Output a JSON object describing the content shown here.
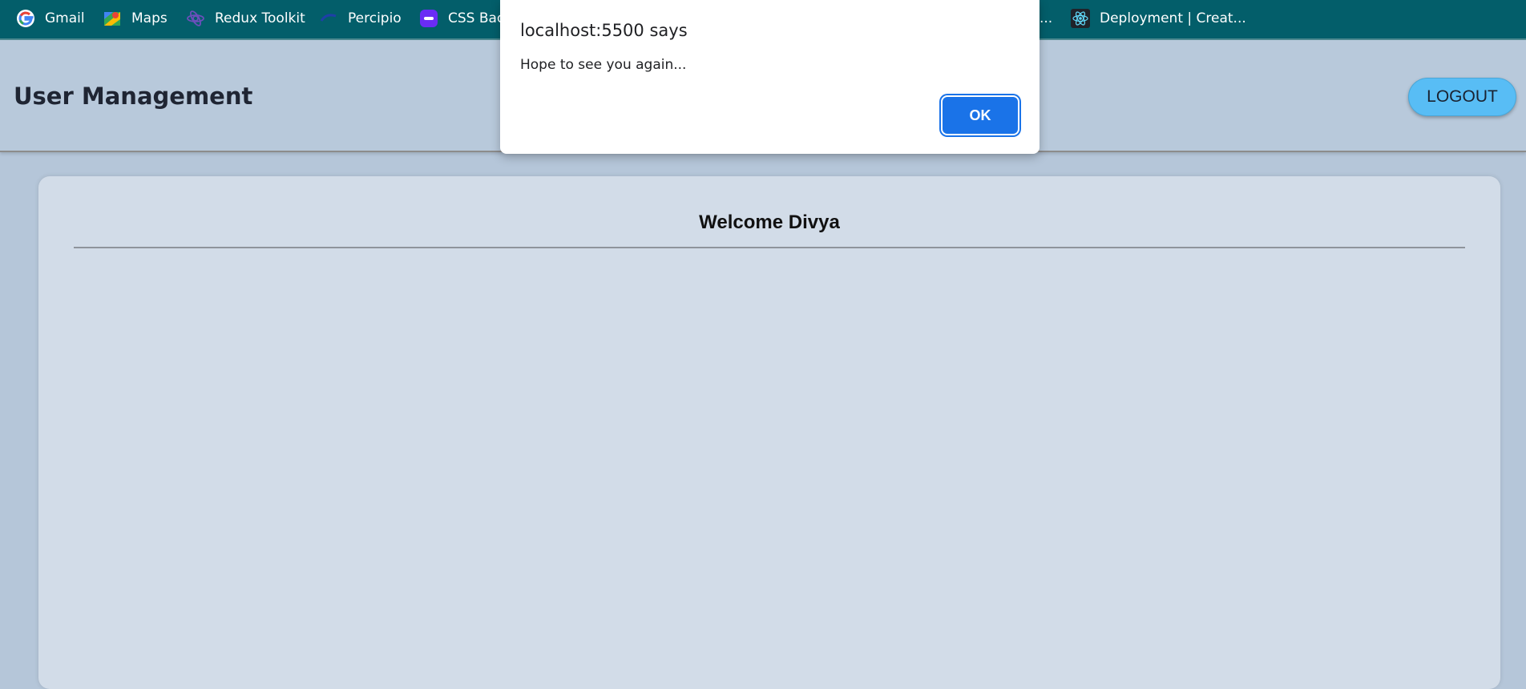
{
  "bookmarks": [
    {
      "label": "Gmail",
      "icon": "google-icon"
    },
    {
      "label": "Maps",
      "icon": "maps-icon"
    },
    {
      "label": "Redux Toolkit",
      "icon": "redux-icon"
    },
    {
      "label": "Percipio",
      "icon": "percipio-icon"
    },
    {
      "label": "CSS Bac",
      "icon": "css-icon"
    },
    {
      "label": "...",
      "icon": ""
    },
    {
      "label": "Deployment | Creat...",
      "icon": "react-icon"
    }
  ],
  "header": {
    "title": "User Management",
    "logout_label": "LOGOUT"
  },
  "main": {
    "welcome": "Welcome Divya"
  },
  "dialog": {
    "title": "localhost:5500 says",
    "message": "Hope to see you again...",
    "ok_label": "OK"
  },
  "colors": {
    "bookmarks_bg": "#035e6a",
    "header_bg": "#b8c9db",
    "logout_bg": "#58bdf5",
    "card_bg": "#d2dce8",
    "ok_bg": "#1a73e8"
  }
}
